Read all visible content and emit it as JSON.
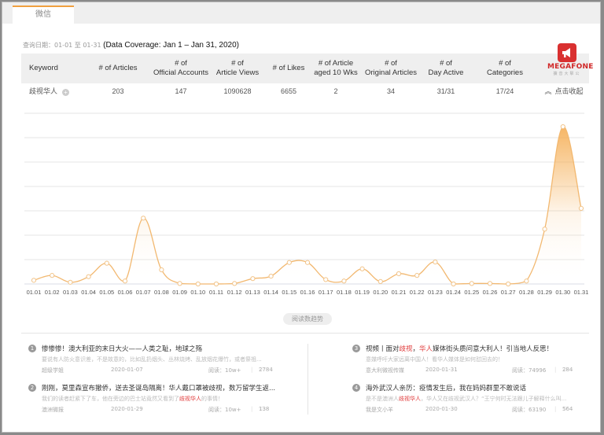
{
  "tabs": [
    {
      "label": "微信",
      "active": true
    }
  ],
  "query": {
    "label": "查询日期：01-01 至 01-31",
    "coverage": "(Data Coverage: Jan 1 – Jan 31, 2020)"
  },
  "stats": {
    "headers": [
      "Keyword",
      "# of Articles",
      "# of\nOfficial Accounts",
      "# of\nArticle Views",
      "# of Likes",
      "# of Article\naged 10 Wks",
      "# of\nOriginal Articles",
      "# of\nDay Active",
      "# of\nCategories"
    ],
    "row": {
      "keyword": "歧视华人",
      "articles": "203",
      "official_accounts": "147",
      "article_views": "1090628",
      "likes": "6655",
      "aged_10_wks": "2",
      "original_articles": "34",
      "day_active": "31/31",
      "categories": "17/24",
      "collapse_label": "点击收起"
    }
  },
  "logo": {
    "name": "MEGAFONE",
    "subtitle": "擴音大擊公",
    "brand_color": "#d93030"
  },
  "trend_button": "阅读数趋势",
  "chart_data": {
    "type": "area",
    "title": "",
    "xlabel": "",
    "ylabel": "",
    "y_unit": "gridline units (no y-axis labels shown)",
    "ylim": [
      0,
      7
    ],
    "grid": true,
    "legend": "none",
    "color": "#f5a94a",
    "categories": [
      "01.01",
      "01.02",
      "01.03",
      "01.04",
      "01.05",
      "01.06",
      "01.07",
      "01.08",
      "01.09",
      "01.10",
      "01.11",
      "01.12",
      "01.13",
      "01.14",
      "01.15",
      "01.16",
      "01.17",
      "01.18",
      "01.19",
      "01.20",
      "01.21",
      "01.22",
      "01.23",
      "01.24",
      "01.25",
      "01.26",
      "01.27",
      "01.28",
      "01.29",
      "01.30",
      "01.31"
    ],
    "series": [
      {
        "name": "阅读数",
        "values": [
          0.15,
          0.35,
          0.07,
          0.3,
          0.85,
          0.12,
          2.7,
          0.58,
          0.02,
          0.0,
          0.0,
          0.02,
          0.22,
          0.32,
          0.88,
          0.88,
          0.18,
          0.12,
          0.62,
          0.1,
          0.42,
          0.35,
          0.9,
          0.0,
          0.02,
          0.02,
          0.0,
          0.12,
          2.25,
          6.45,
          3.1
        ]
      }
    ]
  },
  "articles": [
    {
      "num": "1",
      "title": "惨惨惨！澳大利亚的末日大火——人类之耻，地球之殇",
      "summary_parts": [
        "要说有人防火意识差，不是故意的，比如乱扔烟头、丛林烧烤、乱放烟花爆竹，或者祭祖..."
      ],
      "account": "超级学姐",
      "date": "2020-01-07",
      "reads": "阅读：10w+",
      "likes": "2784"
    },
    {
      "num": "2",
      "title": "刚刚，莫里森宣布撤侨，送去圣诞岛隔离！华人戴口罩被歧视，数万留学生返...",
      "summary_parts": [
        "我们的读者赶紧下了车，他在旁边的巴士站竟然又看到了",
        "歧视华人",
        "的事情！"
      ],
      "account": "澳洲微报",
      "date": "2020-01-29",
      "reads": "阅读：10w+",
      "likes": "138"
    },
    {
      "num": "3",
      "title_parts": [
        "视频丨面对",
        "歧视",
        "，",
        "华人",
        "媒体街头质问意大利人！引当地人反思！"
      ],
      "summary_parts": [
        "意媒呼吁大家远离中国人！看华人媒体是如何怼回去的！"
      ],
      "account": "意大利微视传媒",
      "date": "2020-01-31",
      "reads": "阅读：74996",
      "likes": "284"
    },
    {
      "num": "4",
      "title": "海外武汉人亲历：疫情发生后，我在妈妈群里不敢说话",
      "summary_parts": [
        "是不是澳洲人",
        "歧视华人",
        "，华人又在歧视武汉人？“王宁何时无法跟儿子解释什么叫..."
      ],
      "account": "我是文小羊",
      "date": "2020-01-30",
      "reads": "阅读：63190",
      "likes": "564"
    }
  ]
}
